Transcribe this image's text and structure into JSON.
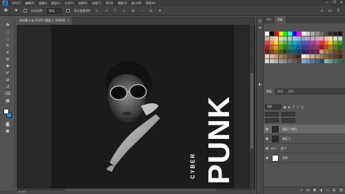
{
  "menubar": {
    "logo": "Ps",
    "items": [
      "文件(F)",
      "编辑(E)",
      "图像(I)",
      "图层(L)",
      "文字(Y)",
      "选择(S)",
      "滤镜(T)",
      "3D(D)",
      "视图(V)",
      "窗口(W)",
      "帮助(H)"
    ],
    "window_controls": [
      "—",
      "❐",
      "✕"
    ]
  },
  "options": {
    "auto_select_label": "自动选择:",
    "auto_select_value": "图层",
    "transform_label": "显示变换控件",
    "more_label": "···"
  },
  "document": {
    "tab_title": "未标题-1 @ 43.6% (图层 1, RGB/8)",
    "tab_close": "×"
  },
  "canvas": {
    "headline": "PUNK",
    "subline": "CYBER",
    "background_color": "#1b1b1b"
  },
  "status": {
    "zoom": "43.6%"
  },
  "panels": {
    "top_tabs": [
      "颜色",
      "色板"
    ],
    "layers_tabs": [
      "图层",
      "通道",
      "路径"
    ],
    "kind_filter": "类型",
    "layers": [
      {
        "name": "图层 2 拷贝",
        "thumb": "photo",
        "selected": true
      },
      {
        "name": "图层 2",
        "thumb": "photo",
        "selected": false
      },
      {
        "name": "组 1",
        "thumb": "folder",
        "selected": false
      },
      {
        "name": "背景",
        "thumb": "white",
        "selected": false
      }
    ]
  },
  "swatch_colors": [
    "#ffffff",
    "#000000",
    "#ff0000",
    "#ffff00",
    "#00ff00",
    "#00ffff",
    "#0000ff",
    "#ff00ff",
    "#f0f0f0",
    "#d0d0d0",
    "#b0b0b0",
    "#909090",
    "#707070",
    "#505050",
    "#303030",
    "#202020",
    "#101010",
    "#f29a94",
    "#f7b98b",
    "#fde08a",
    "#c7e28d",
    "#9fd39a",
    "#8dd2c2",
    "#84cde2",
    "#8db6e0",
    "#9b9fd2",
    "#b39bce",
    "#d49bcc",
    "#ef9bbd",
    "#f0a0a0",
    "#f5c090",
    "#fbe39a",
    "#d8e8a0",
    "#aee0b0",
    "#e8453c",
    "#f08a35",
    "#f9d236",
    "#9bc93b",
    "#4db048",
    "#2cae8f",
    "#1ea6d3",
    "#2f7cc9",
    "#4a59b5",
    "#7c4ba8",
    "#b0479e",
    "#e14b87",
    "#d23b3b",
    "#e97c2a",
    "#f4c21f",
    "#86b52c",
    "#3a9a3c",
    "#b51f24",
    "#c6631d",
    "#c9a318",
    "#6f9527",
    "#2d7d30",
    "#1d8066",
    "#147a9d",
    "#225c98",
    "#313f88",
    "#5a347d",
    "#832f74",
    "#a52e61",
    "#9b1b1b",
    "#a85218",
    "#a88612",
    "#5a7a1f",
    "#236424",
    "#7c1616",
    "#8a4212",
    "#8d6f0e",
    "#4a631a",
    "#1b4f1d",
    "#145a48",
    "#0f566f",
    "#183f6b",
    "#22295f",
    "#3e2357",
    "#5c1f51",
    "#741f44",
    "#c8a27a",
    "#a67c52",
    "#8a623b",
    "#6f4b2a",
    "#55381e",
    "#e8d4b8",
    "#d8b896",
    "#c49a74",
    "#a87e5a",
    "#8c6442",
    "#704c30",
    "#583a24",
    "#3e281a",
    "#f2e6d8",
    "#e0ccb2",
    "#ccb090",
    "#b49472",
    "#9c7a58",
    "#846242",
    "#6c4c30",
    "#563a22",
    "#402a18",
    "#d9d9d9",
    "#c4c4c4",
    "#afafaf",
    "#9a9a9a",
    "#858585",
    "#707070",
    "#5b5b5b",
    "#464646",
    "#8fa9c9",
    "#6f8fb7",
    "#56789f",
    "#416285",
    "#2f4d6b",
    "#8db3a0",
    "#6b9a84",
    "#4f806a",
    "#386652"
  ]
}
